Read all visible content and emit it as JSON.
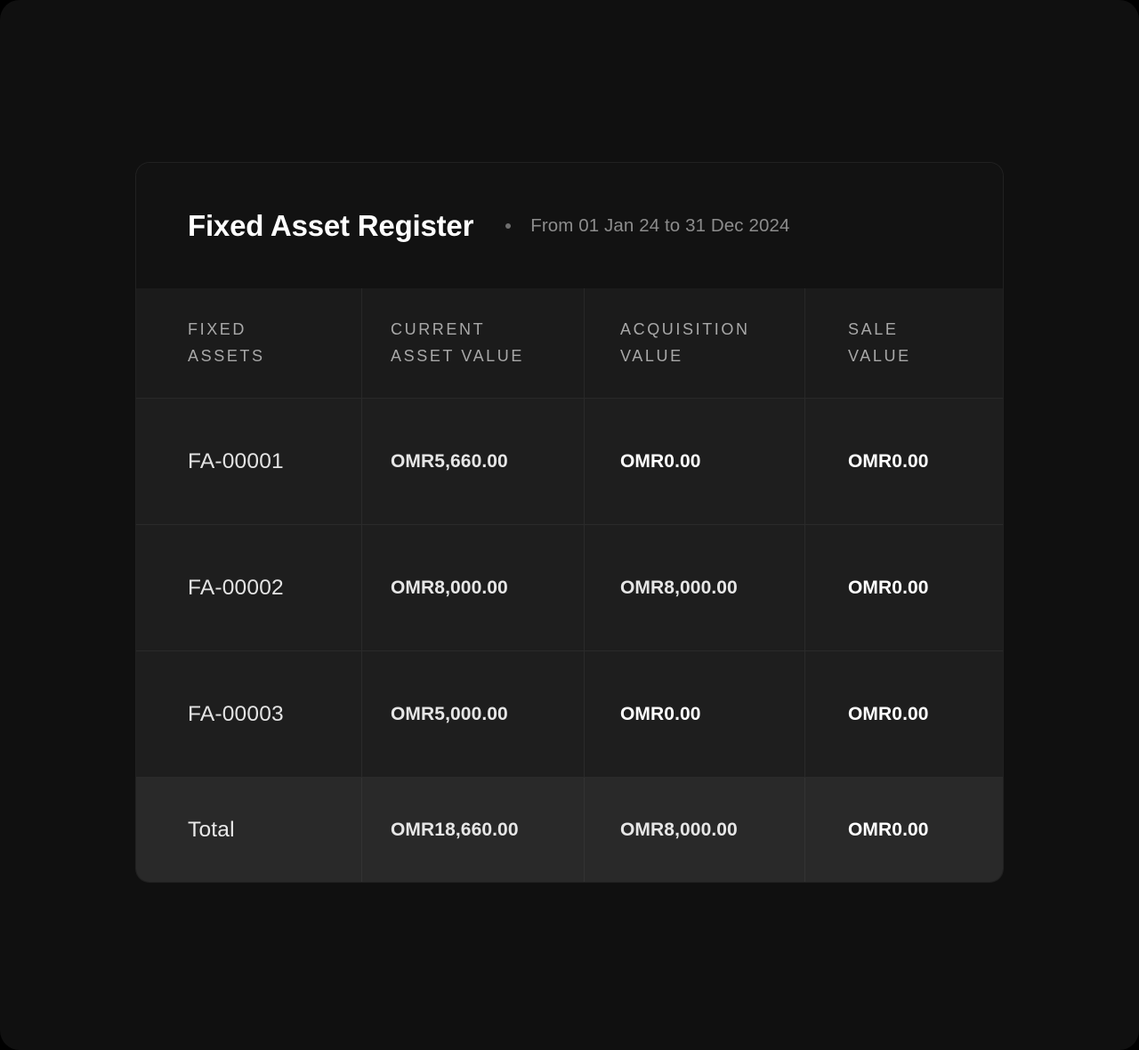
{
  "card": {
    "title": "Fixed Asset Register",
    "separator": "•",
    "period": "From 01 Jan 24 to 31 Dec 2024"
  },
  "table": {
    "columns": [
      {
        "label": "FIXED\nASSETS",
        "name": "fixed-assets"
      },
      {
        "label": "CURRENT\nASSET VALUE",
        "name": "current-asset-value"
      },
      {
        "label": "ACQUISITION\nVALUE",
        "name": "acquisition-value"
      },
      {
        "label": "SALE\nVALUE",
        "name": "sale-value"
      }
    ],
    "rows": [
      {
        "asset": "FA-00001",
        "current_asset_value": "OMR5,660.00",
        "acquisition_value": "OMR0.00",
        "sale_value": "OMR0.00"
      },
      {
        "asset": "FA-00002",
        "current_asset_value": "OMR8,000.00",
        "acquisition_value": "OMR8,000.00",
        "sale_value": "OMR0.00"
      },
      {
        "asset": "FA-00003",
        "current_asset_value": "OMR5,000.00",
        "acquisition_value": "OMR0.00",
        "sale_value": "OMR0.00"
      }
    ],
    "total": {
      "label": "Total",
      "current_asset_value": "OMR18,660.00",
      "acquisition_value": "OMR8,000.00",
      "sale_value": "OMR0.00"
    }
  },
  "colors": {
    "page_background": "#101010",
    "card_background": "#151515",
    "header_background": "#121212",
    "table_header_background": "#1b1b1b",
    "row_background": "#1e1e1e",
    "total_row_background": "#292929",
    "title_text": "#ffffff",
    "period_text": "#8c8c8c",
    "column_header_text": "#a8a8a8",
    "value_text": "#e6e6e6"
  }
}
